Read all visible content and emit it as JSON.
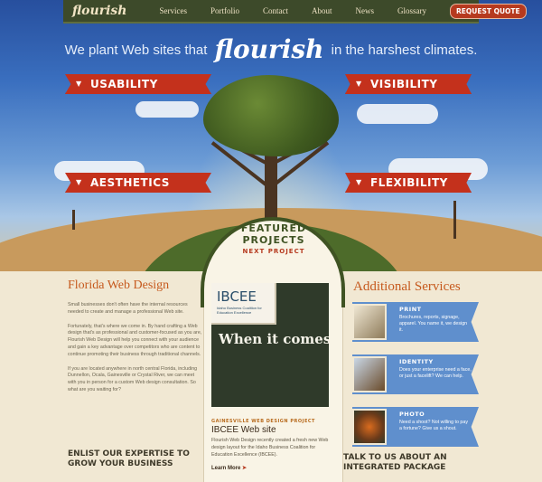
{
  "nav": {
    "logo": "flourish",
    "links": [
      "Services",
      "Portfolio",
      "Contact",
      "About",
      "News",
      "Glossary"
    ],
    "cta": "REQUEST QUOTE"
  },
  "hero": {
    "tagline_before": "We plant Web sites that",
    "tagline_brand": "flourish",
    "tagline_after": "in the harshest climates.",
    "ribbons": {
      "usability": "USABILITY",
      "visibility": "VISIBILITY",
      "aesthetics": "AESTHETICS",
      "flexibility": "FLEXIBILITY"
    }
  },
  "left": {
    "heading": "Florida Web Design",
    "paragraphs": [
      "Small businesses don't often have the internal resources needed to create and manage a professional Web site.",
      "Fortunately, that's where we come in. By hand crafting a Web design that's as professional and customer-focused as you are, Flourish Web Design will help you connect with your audience and gain a key advantage over competitors who are content to continue promoting their business through traditional channels.",
      "If you are located anywhere in north central Florida, including Dunnellon, Ocala, Gainesville or Crystal River, we can meet with you in person for a custom Web design consultation. So what are you waiting for?"
    ],
    "cta": "ENLIST OUR EXPERTISE TO GROW YOUR BUSINESS"
  },
  "featured": {
    "arch_title": "FEATURED PROJECTS",
    "arch_sub": "NEXT PROJECT",
    "logo_mark": "IBCEE",
    "logo_sub": "Idaho Business Coalition for Education Excellence",
    "headline": "When it comes to education, we m",
    "kicker": "GAINESVILLE WEB DESIGN PROJECT",
    "title": "IBCEE Web site",
    "description": "Flourish Web Design recently created a fresh new Web design layout for the Idaho Business Coalition for Education Excellence (IBCEE).",
    "link": "Learn More"
  },
  "services": {
    "heading": "Additional Services",
    "items": [
      {
        "title": "PRINT",
        "desc": "Brochures, reports, signage, apparel. You name it, we design it."
      },
      {
        "title": "IDENTITY",
        "desc": "Does your enterprise need a face, or just a facelift? We can help."
      },
      {
        "title": "PHOTO",
        "desc": "Need a shoot? Not willing to pay a fortune? Give us a shout."
      }
    ],
    "cta": "TALK TO US ABOUT AN INTEGRATED PACKAGE"
  },
  "colors": {
    "accent_red": "#c4311c",
    "heading_orange": "#c65a1e",
    "nav_bg": "#3d4a2a",
    "service_blue": "#5f8fcd"
  }
}
